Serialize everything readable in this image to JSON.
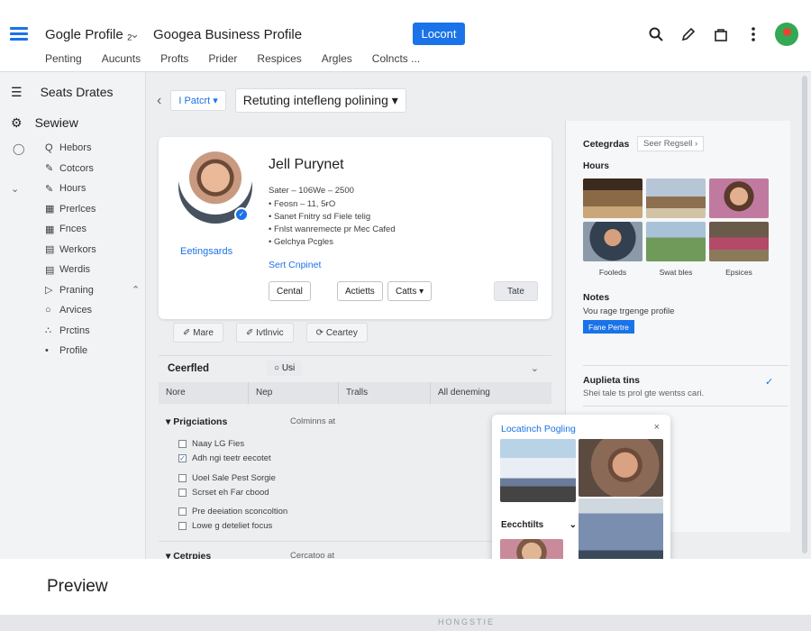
{
  "header": {
    "app_title": "Gogle Profile",
    "app_title_suffix": "₂",
    "caret": "⌄",
    "business_title": "Googea Business Profile",
    "primary_button": "Locont",
    "subnav": [
      "Penting",
      "Aucunts",
      "Profts",
      "Prider",
      "Respices",
      "Argles",
      "Colncts ..."
    ]
  },
  "sidebar": {
    "heading": "Seats Drates",
    "section": "Sewiew",
    "items": [
      {
        "lead": "",
        "icon": "Q",
        "label": "Hebors",
        "trail": ""
      },
      {
        "lead": "",
        "icon": "✎",
        "label": "Cotcors",
        "trail": ""
      },
      {
        "lead": "⌄",
        "icon": "✎",
        "label": "Hours",
        "trail": ""
      },
      {
        "lead": "",
        "icon": "▦",
        "label": "Prerlces",
        "trail": ""
      },
      {
        "lead": "",
        "icon": "▦",
        "label": "Fnces",
        "trail": ""
      },
      {
        "lead": "",
        "icon": "▤",
        "label": "Werkors",
        "trail": ""
      },
      {
        "lead": "",
        "icon": "▤",
        "label": "Werdis",
        "trail": ""
      },
      {
        "lead": "",
        "icon": "▷",
        "label": "Praning",
        "trail": "⌃"
      },
      {
        "lead": "",
        "icon": "○",
        "label": "Arvices",
        "trail": ""
      },
      {
        "lead": "",
        "icon": "∴",
        "label": "Prctins",
        "trail": ""
      },
      {
        "lead": "",
        "icon": "•",
        "label": "Profile",
        "trail": ""
      }
    ]
  },
  "toolbar": {
    "back": "‹",
    "filter_chip": "I Patcrt ▾",
    "dropdown": "Retuting intefleng polining ▾",
    "forward": "›"
  },
  "profile": {
    "name": "Jell Purynet",
    "badge": "✓",
    "photo_caption": "Eetingsards",
    "lines": [
      "Sater – 106We – 2500",
      "• Feosn – 11, 5ғO",
      "• Sanet Fnitry sd Fiele telig",
      "• Fnlst wanremecte pr Mec Cafed",
      "• Gelchya Pcgles"
    ],
    "link": "Sert Cnpinet",
    "buttons": [
      "Cental",
      "Actietts",
      "Catts ▾"
    ],
    "gray_button": "Tate"
  },
  "actions": [
    "✐ Mare",
    "✐ Ivtlnvic",
    "⟳ Ceartey"
  ],
  "section": {
    "title": "Ceerfled",
    "chip": "○ Usi",
    "chevron": "⌄",
    "columns": [
      "Nore",
      "Nep",
      "Tralls",
      "All deneming"
    ]
  },
  "groups": [
    {
      "title": "▾ Prigciations",
      "aside": "Colminns at",
      "items": [
        {
          "checked": false,
          "label": "Naay LG Fies"
        },
        {
          "checked": true,
          "label": "Adh ngi teetr eecotet"
        },
        {
          "checked": false,
          "label": "Uoel Sale Pest Sorgie"
        },
        {
          "checked": false,
          "label": "Scrset eh Far cbood"
        },
        {
          "checked": false,
          "label": "Pre deeiation sconcoltion"
        },
        {
          "checked": false,
          "label": "Lowe g deteliet focus"
        }
      ]
    },
    {
      "title": "▾ Cetrpies",
      "aside": "Cercatoo at",
      "items": []
    }
  ],
  "right_panel": {
    "categories_label": "Cetegrdas",
    "categories_button": "Seer Regsell ›",
    "hours_label": "Hours",
    "thumb_captions": [
      "Fooleds",
      "Swat bles",
      "Epsices"
    ],
    "notes_label": "Notes",
    "notes_text": "Vou rage trgenge profile",
    "notes_button": "Fane Pertre",
    "updates_label": "Auplieta tins",
    "updates_text": "Shei tale ts prol gte wentss cari.",
    "updates_check": "✓"
  },
  "popup": {
    "title": "Locatinch Pogling",
    "close": "×",
    "field": "Eecchtilts",
    "field_caret": "⌄"
  },
  "footer": {
    "label": "Preview",
    "strip": "HONGSTIE"
  },
  "colors": {
    "accent": "#1a73e8",
    "avatar": "#34a853"
  }
}
